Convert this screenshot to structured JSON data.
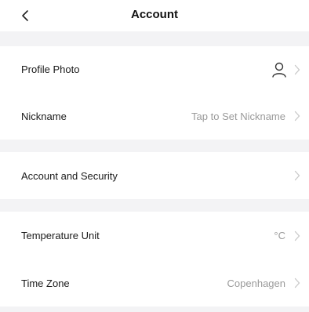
{
  "header": {
    "title": "Account",
    "back_icon": "chevron-left-icon"
  },
  "rows": {
    "profile_photo": {
      "label": "Profile Photo",
      "icon": "user-icon"
    },
    "nickname": {
      "label": "Nickname",
      "value": "Tap to Set Nickname"
    },
    "account_security": {
      "label": "Account and Security"
    },
    "temperature_unit": {
      "label": "Temperature Unit",
      "value": "°C"
    },
    "time_zone": {
      "label": "Time Zone",
      "value": "Copenhagen"
    }
  },
  "colors": {
    "background": "#ffffff",
    "section_gap": "#f3f3f5",
    "label_text": "#1a1a1a",
    "value_text": "#9a9a9a",
    "chevron": "#c8c8c8"
  }
}
